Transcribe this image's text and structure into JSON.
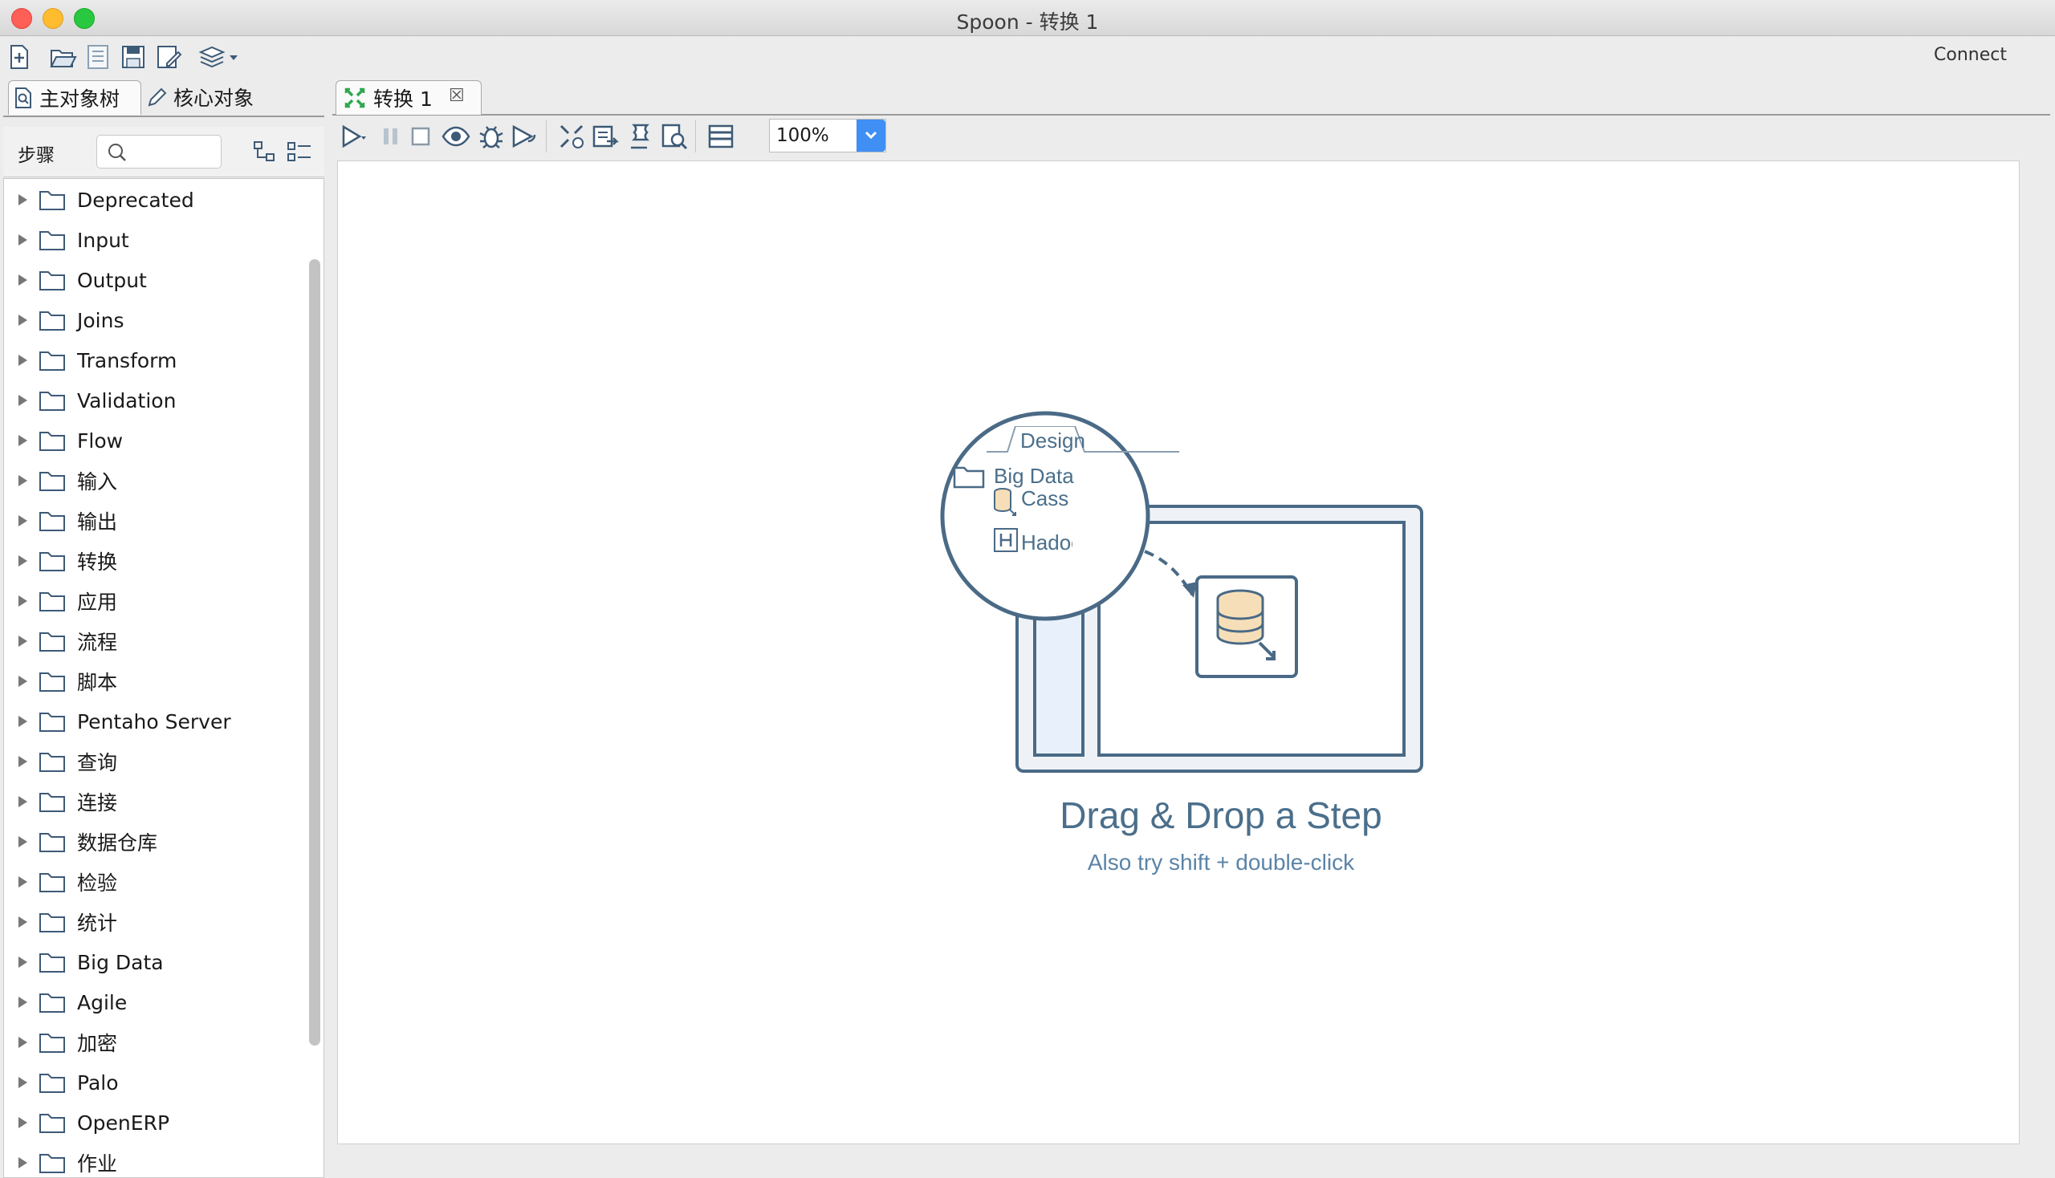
{
  "window": {
    "title": "Spoon - 转换 1"
  },
  "toolbar": {
    "connect_label": "Connect"
  },
  "left_panel": {
    "tabs": [
      {
        "label": "主对象树"
      },
      {
        "label": "核心对象"
      }
    ],
    "steps_label": "步骤",
    "tree_items": [
      "Deprecated",
      "Input",
      "Output",
      "Joins",
      "Transform",
      "Validation",
      "Flow",
      "输入",
      "输出",
      "转换",
      "应用",
      "流程",
      "脚本",
      "Pentaho Server",
      "查询",
      "连接",
      "数据仓库",
      "检验",
      "统计",
      "Big Data",
      "Agile",
      "加密",
      "Palo",
      "OpenERP",
      "作业"
    ]
  },
  "editor": {
    "tab_label": "转换 1",
    "zoom": "100%",
    "illustration": {
      "tab_label": "Design",
      "folder_label": "Big Data",
      "item1": "Cassandr",
      "item2": "Hadoop"
    },
    "hint_title": "Drag & Drop a Step",
    "hint_subtitle": "Also try shift + double-click"
  },
  "colors": {
    "accent": "#3f8ff4",
    "illustration": "#4a6a86"
  }
}
